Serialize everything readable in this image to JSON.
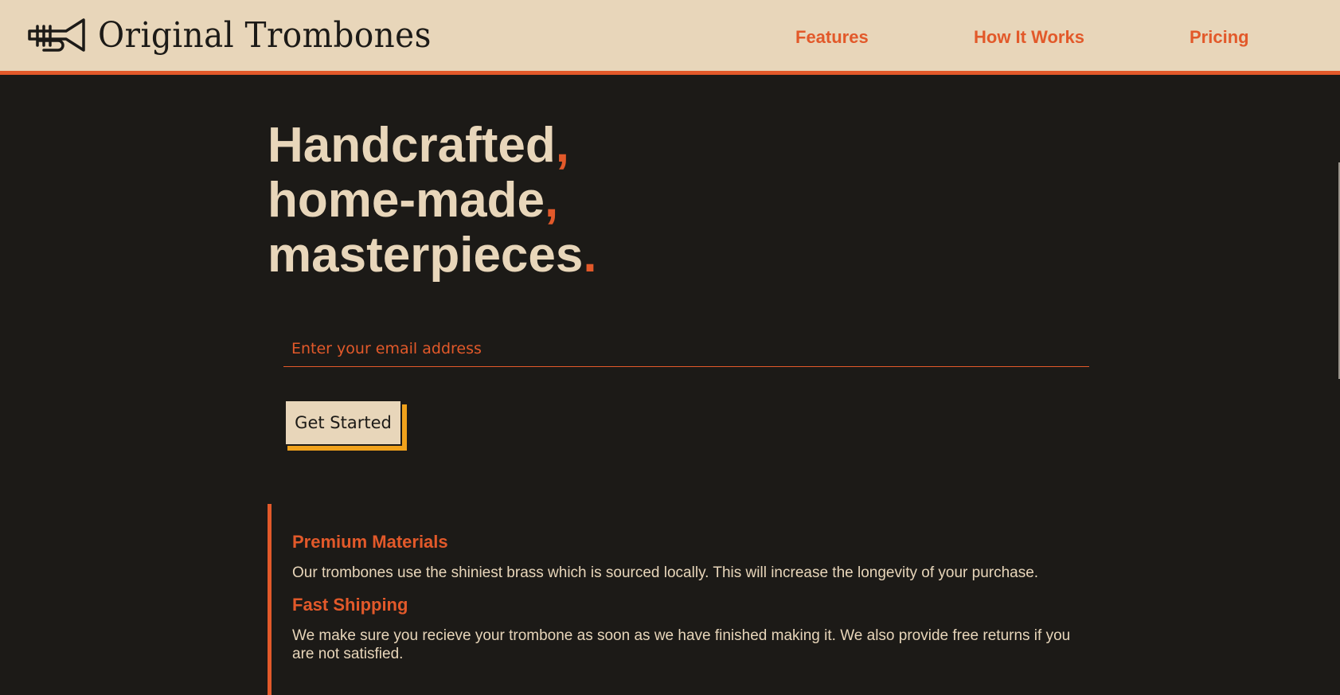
{
  "header": {
    "brand": "Original Trombones",
    "nav": [
      {
        "label": "Features"
      },
      {
        "label": "How It Works"
      },
      {
        "label": "Pricing"
      }
    ]
  },
  "hero": {
    "line1": "Handcrafted",
    "line2": "home-made",
    "line3": "masterpieces",
    "comma": ",",
    "period": "."
  },
  "signup": {
    "email_placeholder": "Enter your email address",
    "email_value": "",
    "button_label": "Get Started"
  },
  "features": [
    {
      "title": "Premium Materials",
      "text": "Our trombones use the shiniest brass which is sourced locally. This will increase the longevity of your purchase."
    },
    {
      "title": "Fast Shipping",
      "text": "We make sure you recieve your trombone as soon as we have finished making it. We also provide free returns if you are not satisfied."
    }
  ],
  "colors": {
    "background": "#1c1a17",
    "header_bg": "#e8d6ba",
    "accent": "#e2592a",
    "button_shadow": "#f0a21c"
  },
  "icons": {
    "logo": "trumpet-icon"
  }
}
